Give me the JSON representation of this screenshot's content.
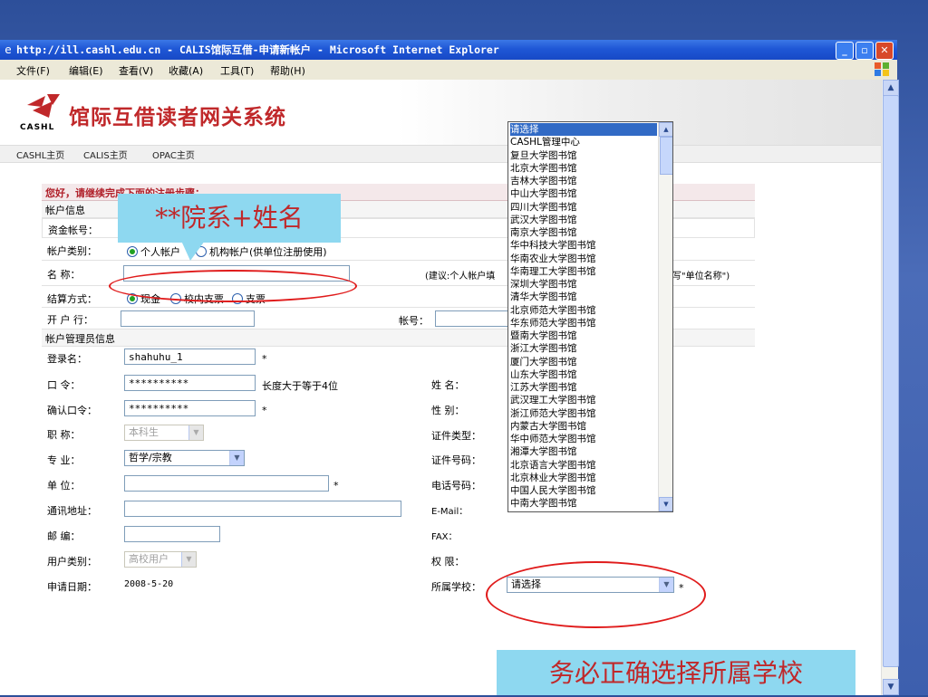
{
  "window": {
    "title": "http://ill.cashl.edu.cn - CALIS馆际互借-申请新帐户 - Microsoft Internet Explorer"
  },
  "menu": [
    "文件(F)",
    "编辑(E)",
    "查看(V)",
    "收藏(A)",
    "工具(T)",
    "帮助(H)"
  ],
  "header": {
    "logo_text": "CASHL",
    "site_title": "馆际互借读者网关系统"
  },
  "nav": [
    "CASHL主页",
    "CALIS主页",
    "OPAC主页"
  ],
  "form": {
    "greeting": "您好，请继续完成下面的注册步骤：",
    "section_account": "帐户信息",
    "fund_account_label": "资金帐号：",
    "account_type_label": "帐户类别：",
    "account_type_personal": "个人帐户",
    "account_type_org": "机构帐户(供单位注册使用)",
    "name_label": "名 称：",
    "name_hint_left": "(建议:个人帐户填",
    "name_hint_right": "写\"单位名称\")",
    "settlement_label": "结算方式：",
    "settlement_cash": "现金",
    "settlement_check_internal": "校内支票",
    "settlement_check": "支票",
    "bank_label": "开 户 行：",
    "bank_account_label": "帐号：",
    "section_admin": "帐户管理员信息",
    "login_label": "登录名：",
    "login_value": "shahuhu_1",
    "password_label": "口 令：",
    "password_value": "**********",
    "password_hint": "长度大于等于4位",
    "confirm_label": "确认口令：",
    "confirm_value": "**********",
    "required_mark": "*",
    "title_label": "职 称：",
    "title_value": "本科生",
    "major_label": "专 业：",
    "major_value": "哲学/宗教",
    "unit_label": "单 位：",
    "address_label": "通讯地址：",
    "postcode_label": "邮 编：",
    "user_type_label": "用户类别：",
    "user_type_value": "高校用户",
    "date_label": "申请日期：",
    "date_value": "2008-5-20",
    "surname_label": "姓 名：",
    "gender_label": "性 别：",
    "id_type_label": "证件类型：",
    "id_number_label": "证件号码：",
    "phone_label": "电话号码：",
    "email_label": "E-Mail：",
    "fax_label": "FAX：",
    "permission_label": "权 限：",
    "school_label": "所属学校：",
    "school_value": "请选择"
  },
  "school_options": [
    "请选择",
    "CASHL管理中心",
    "复旦大学图书馆",
    "北京大学图书馆",
    "吉林大学图书馆",
    "中山大学图书馆",
    "四川大学图书馆",
    "武汉大学图书馆",
    "南京大学图书馆",
    "华中科技大学图书馆",
    "华南农业大学图书馆",
    "华南理工大学图书馆",
    "深圳大学图书馆",
    "清华大学图书馆",
    "北京师范大学图书馆",
    "华东师范大学图书馆",
    "暨南大学图书馆",
    "浙江大学图书馆",
    "厦门大学图书馆",
    "山东大学图书馆",
    "江苏大学图书馆",
    "武汉理工大学图书馆",
    "浙江师范大学图书馆",
    "内蒙古大学图书馆",
    "华中师范大学图书馆",
    "湘潭大学图书馆",
    "北京语言大学图书馆",
    "北京林业大学图书馆",
    "中国人民大学图书馆",
    "中南大学图书馆"
  ],
  "annotations": {
    "callout_name": "**院系+姓名",
    "callout_school": "务必正确选择所属学校"
  },
  "colors": {
    "title_red": "#c0282a",
    "callout_bg": "#8ed8f0",
    "highlight_ellipse": "#e01b1b",
    "xp_titlebar": "#1f57d6",
    "selected_option": "#316ac5"
  }
}
